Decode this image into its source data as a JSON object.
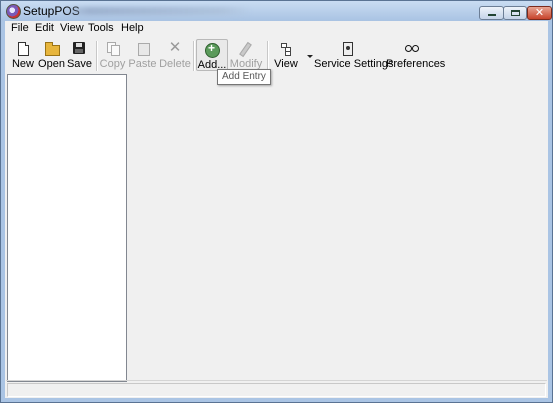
{
  "window": {
    "title": "SetupPOS",
    "minimize_label": "",
    "close_label": "✕"
  },
  "menu": {
    "file": "File",
    "edit": "Edit",
    "view": "View",
    "tools": "Tools",
    "help": "Help"
  },
  "toolbar": {
    "new": "New",
    "open": "Open",
    "save": "Save",
    "copy": "Copy",
    "paste": "Paste",
    "delete": "Delete",
    "add": "Add...",
    "modify": "Modify",
    "view": "View",
    "service_settings": "Service Settings",
    "preferences": "Preferences"
  },
  "tooltip": {
    "text": "Add Entry"
  },
  "colors": {
    "title_gradient_top": "#c9dcf2",
    "client_bg": "#f0f0f0",
    "disabled_text": "#a0a0a0"
  },
  "icons": {
    "new": "new-document-icon",
    "open": "open-folder-icon",
    "save": "floppy-disk-icon",
    "copy": "copy-icon",
    "paste": "paste-icon",
    "delete": "delete-x-icon",
    "add": "add-entry-icon",
    "modify": "pencil-icon",
    "view": "tree-view-icon",
    "service_settings": "service-settings-icon",
    "preferences": "glasses-icon"
  }
}
